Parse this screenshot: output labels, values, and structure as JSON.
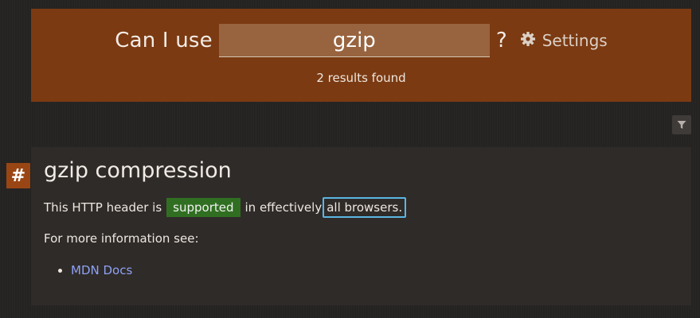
{
  "header": {
    "prefix": "Can I use",
    "search_value": "gzip",
    "suffix": "?",
    "settings_label": "Settings",
    "results_text": "2 results found",
    "background_color": "#7b3a12"
  },
  "toolbar": {
    "filter_icon": "filter-icon"
  },
  "feature": {
    "anchor_symbol": "#",
    "title": "gzip compression",
    "description": {
      "before": "This HTTP header is",
      "badge": "supported",
      "middle": "in effectively",
      "highlight": "all browsers."
    },
    "more_info_label": "For more information see:",
    "links": [
      {
        "label": "MDN Docs"
      }
    ],
    "badge_color": "#306f21",
    "link_color": "#8ea2f5"
  }
}
